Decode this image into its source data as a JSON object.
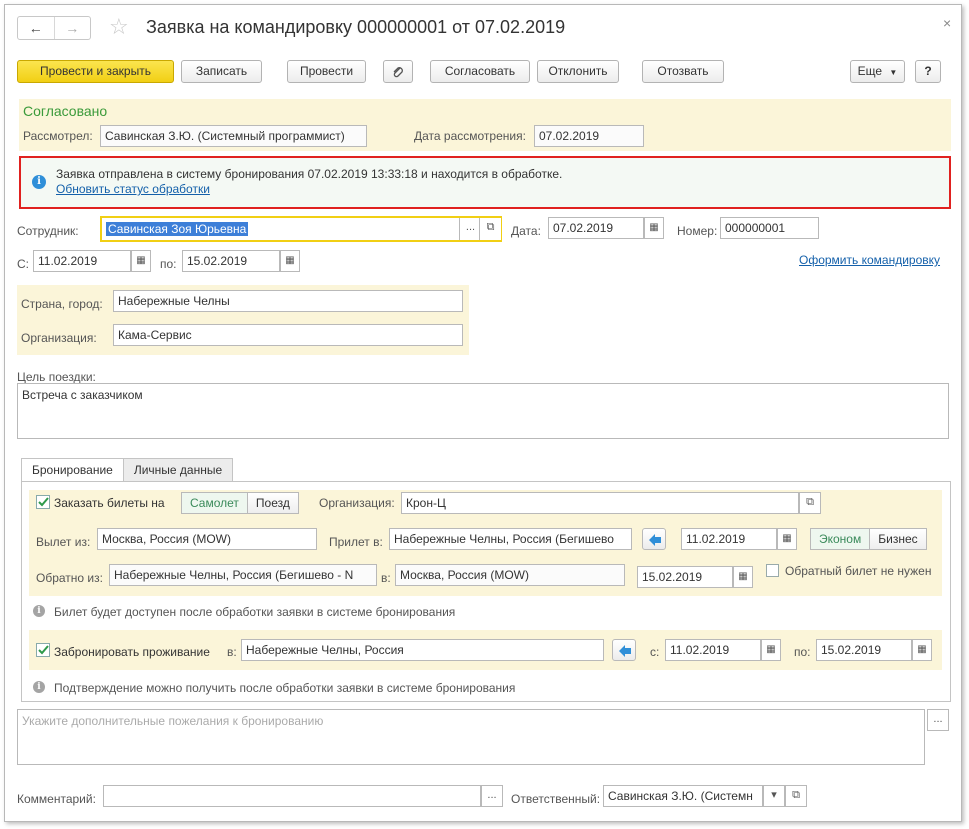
{
  "window": {
    "title": "Заявка на командировку 000000001 от 07.02.2019",
    "nav_back": "←",
    "nav_forward": "→",
    "close": "×"
  },
  "toolbar": {
    "post_close": "Провести и закрыть",
    "write": "Записать",
    "post": "Провести",
    "approve": "Согласовать",
    "reject": "Отклонить",
    "recall": "Отозвать",
    "more": "Еще",
    "help": "?"
  },
  "status": {
    "state": "Согласовано",
    "reviewer_label": "Рассмотрел:",
    "reviewer_value": "Савинская З.Ю. (Системный программист)",
    "review_date_label": "Дата рассмотрения:",
    "review_date_value": "07.02.2019"
  },
  "notice": {
    "text": "Заявка отправлена в систему бронирования 07.02.2019 13:33:18 и находится в обработке.",
    "link": "Обновить статус обработки"
  },
  "employee": {
    "label": "Сотрудник:",
    "value": "Савинская Зоя Юрьевна",
    "date_label": "Дата:",
    "date_value": "07.02.2019",
    "number_label": "Номер:",
    "number_value": "000000001"
  },
  "period": {
    "from_label": "С:",
    "from_value": "11.02.2019",
    "to_label": "по:",
    "to_value": "15.02.2019",
    "issue_link": "Оформить командировку"
  },
  "destination": {
    "city_label": "Страна, город:",
    "city_value": "Набережные Челны",
    "org_label": "Организация:",
    "org_value": "Кама-Сервис"
  },
  "purpose": {
    "label": "Цель поездки:",
    "value": "Встреча с заказчиком"
  },
  "tabs": [
    "Бронирование",
    "Личные данные"
  ],
  "booking": {
    "tickets_label": "Заказать билеты на",
    "transport_options": [
      "Самолет",
      "Поезд"
    ],
    "org_label": "Организация:",
    "org_value": "Крон-Ц",
    "depart_label": "Вылет из:",
    "depart_value": "Москва, Россия (MOW)",
    "arrive_label": "Прилет в:",
    "arrive_value": "Набережные Челны, Россия (Бегишево",
    "depart_date": "11.02.2019",
    "class_options": [
      "Эконом",
      "Бизнес"
    ],
    "return_label": "Обратно из:",
    "return_from_value": "Набережные Челны, Россия (Бегишево  - N",
    "return_to_label": "в:",
    "return_to_value": "Москва, Россия (MOW)",
    "return_date": "15.02.2019",
    "no_return_label": "Обратный билет не нужен",
    "ticket_note": "Билет будет доступен после обработки заявки в системе бронирования",
    "hotel_label": "Забронировать проживание",
    "hotel_in_label": "в:",
    "hotel_in_value": "Набережные Челны, Россия",
    "hotel_from_label": "с:",
    "hotel_from_value": "11.02.2019",
    "hotel_to_label": "по:",
    "hotel_to_value": "15.02.2019",
    "hotel_note": "Подтверждение можно получить после обработки заявки в системе бронирования"
  },
  "wishes": {
    "placeholder": "Укажите дополнительные пожелания к бронированию"
  },
  "footer": {
    "comment_label": "Комментарий:",
    "comment_value": "",
    "responsible_label": "Ответственный:",
    "responsible_value": "Савинская З.Ю. (Системн"
  },
  "colors": {
    "accent_yellow": "#f1cf14",
    "status_green": "#3a9a3a",
    "link_blue": "#1460aa",
    "notice_border": "#e0211f",
    "highlight_bg": "#fbf5d9"
  }
}
